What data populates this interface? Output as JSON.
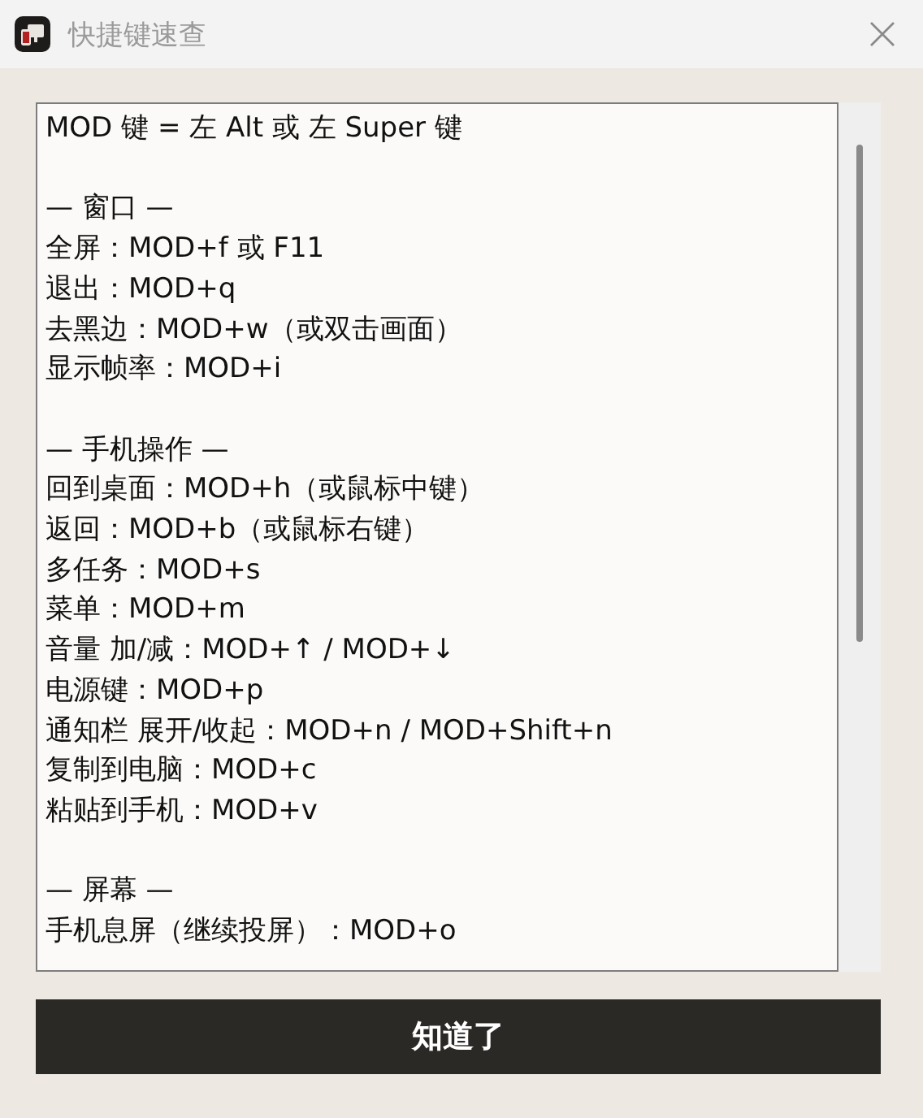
{
  "window": {
    "title": "快捷键速查"
  },
  "shortcuts": {
    "intro": "MOD 键 = 左 Alt 或 左 Super 键",
    "sections": [
      {
        "heading": "— 窗口 —",
        "lines": [
          "全屏：MOD+f 或 F11",
          "退出：MOD+q",
          "去黑边：MOD+w（或双击画面）",
          "显示帧率：MOD+i"
        ]
      },
      {
        "heading": "— 手机操作 —",
        "lines": [
          "回到桌面：MOD+h（或鼠标中键）",
          "返回：MOD+b（或鼠标右键）",
          "多任务：MOD+s",
          "菜单：MOD+m",
          "音量 加/减：MOD+↑ / MOD+↓",
          "电源键：MOD+p",
          "通知栏 展开/收起：MOD+n / MOD+Shift+n",
          "复制到电脑：MOD+c",
          "粘贴到手机：MOD+v"
        ]
      },
      {
        "heading": "— 屏幕 —",
        "lines": [
          "手机息屏（继续投屏）：MOD+o"
        ]
      }
    ]
  },
  "button": "知道了"
}
